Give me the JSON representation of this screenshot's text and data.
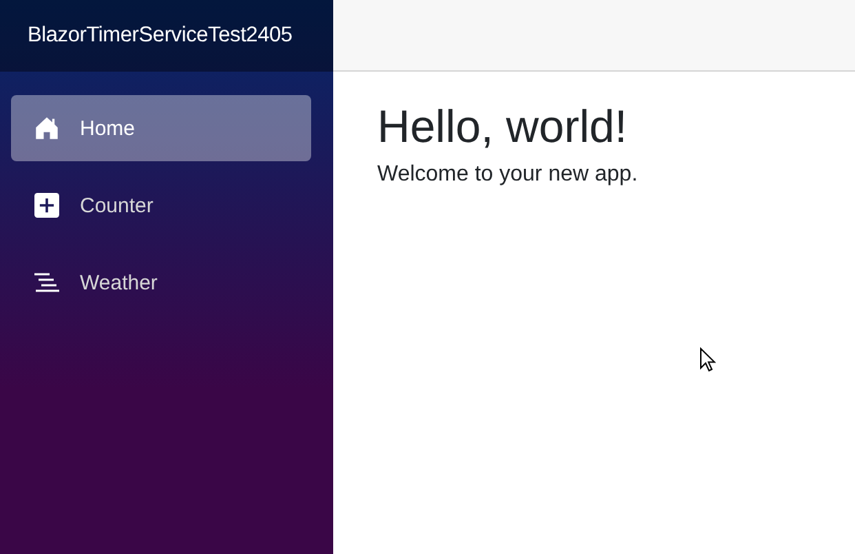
{
  "sidebar": {
    "brand": "BlazorTimerServiceTest2405",
    "items": [
      {
        "kind": "home",
        "label": "Home",
        "selected": true
      },
      {
        "kind": "plus",
        "label": "Counter",
        "selected": false
      },
      {
        "kind": "list",
        "label": "Weather",
        "selected": false
      }
    ]
  },
  "content": {
    "heading": "Hello, world!",
    "text": "Welcome to your new app."
  }
}
